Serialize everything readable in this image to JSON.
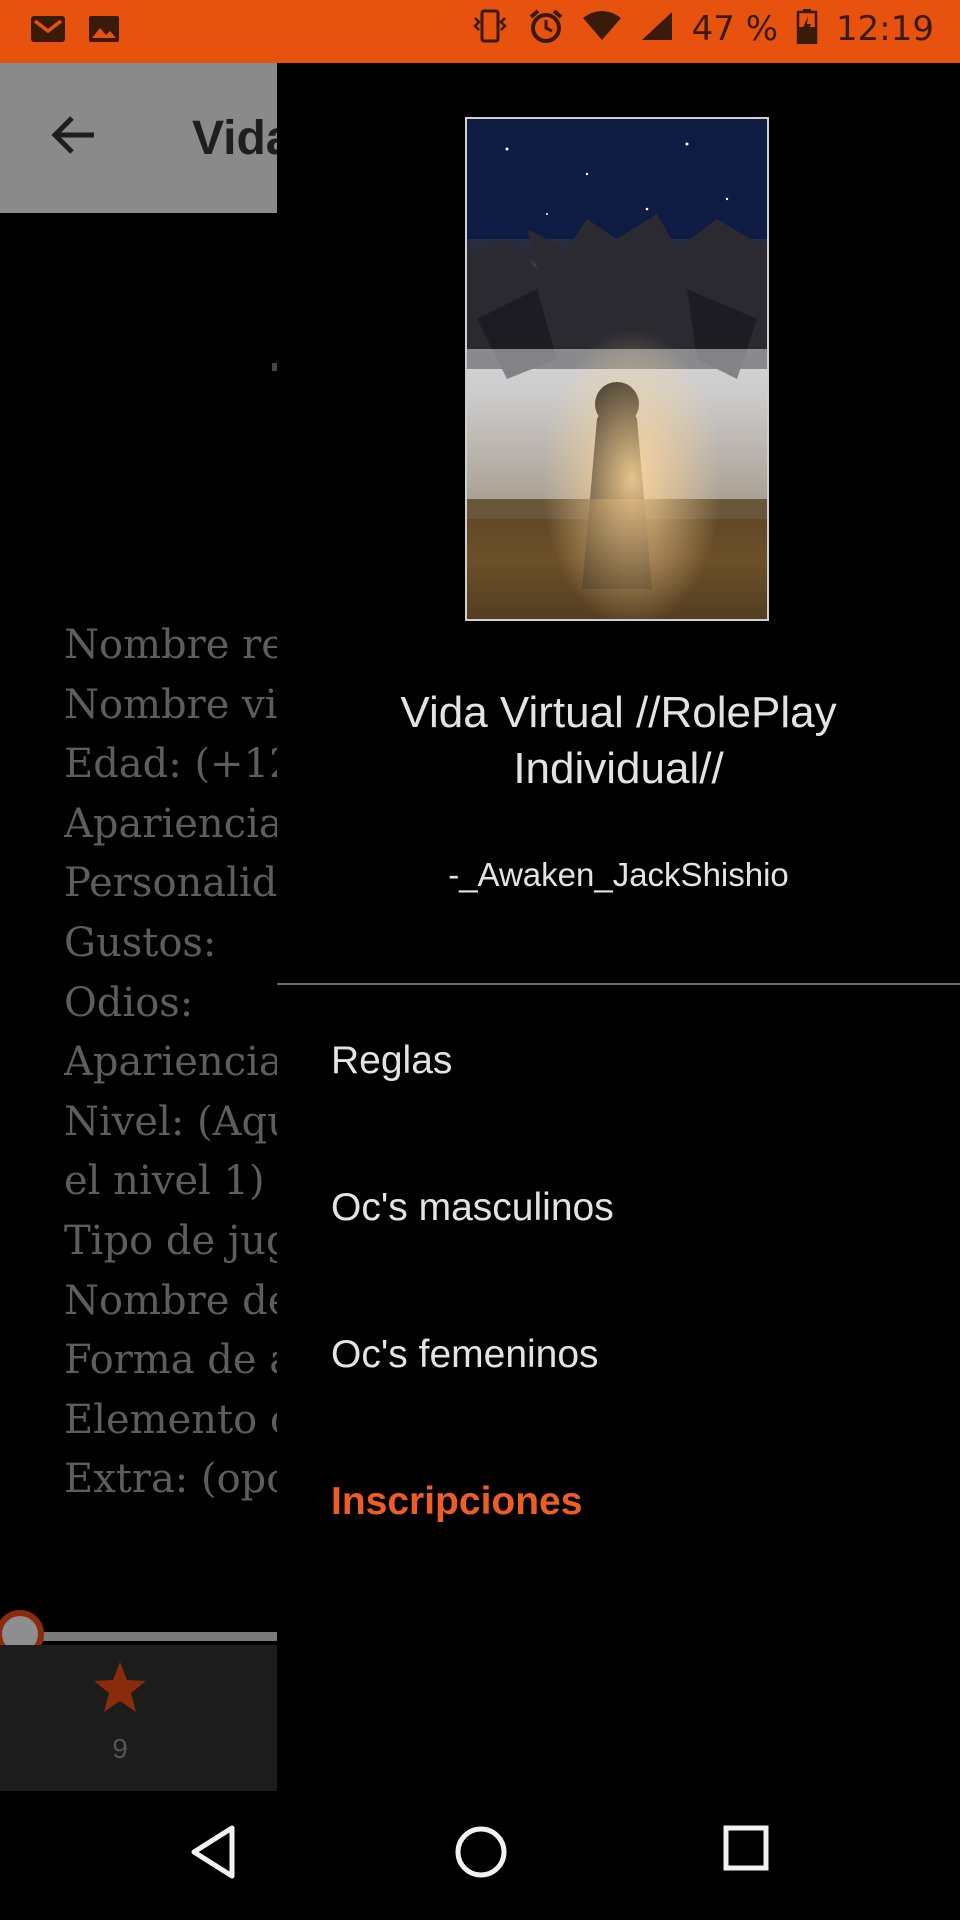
{
  "status_bar": {
    "left_icons": [
      "gmail-icon",
      "image-icon"
    ],
    "right_icons": [
      "vibrate-icon",
      "alarm-icon",
      "wifi-icon",
      "signal-icon"
    ],
    "battery": "47 %",
    "time": "12:19"
  },
  "background_app": {
    "toolbar_title": "Vida",
    "lines": [
      "Nombre re",
      "Nombre vi",
      "Edad: (+12",
      "Apariencia",
      "Personalid",
      "Gustos:",
      "Odios:",
      "Apariencia",
      "Nivel: (Aqu",
      "el nivel 1)",
      "Tipo de jug",
      "Nombre de",
      "Forma de a",
      "Elemento c",
      "Extra: (opc"
    ],
    "star_count": "9"
  },
  "drawer": {
    "cover_lettering": [
      "Vida Virtual",
      "RolePlay Individual",
      "Awaken_JackShishio"
    ],
    "title_line1": "Vida Virtual //RolePlay",
    "title_line2": "Individual//",
    "author": "-_Awaken_JackShishio",
    "menu": [
      {
        "label": "Reglas",
        "active": false
      },
      {
        "label": "Oc's masculinos",
        "active": false
      },
      {
        "label": "Oc's femeninos",
        "active": false
      },
      {
        "label": "Inscripciones",
        "active": true
      }
    ]
  },
  "nav_bar": {
    "buttons": [
      "back-icon",
      "home-icon",
      "recents-icon"
    ]
  },
  "colors": {
    "status_bar": "#e8520f",
    "accent": "#ef5c24",
    "drawer_bg": "#000000",
    "text": "#e3e3e3"
  }
}
